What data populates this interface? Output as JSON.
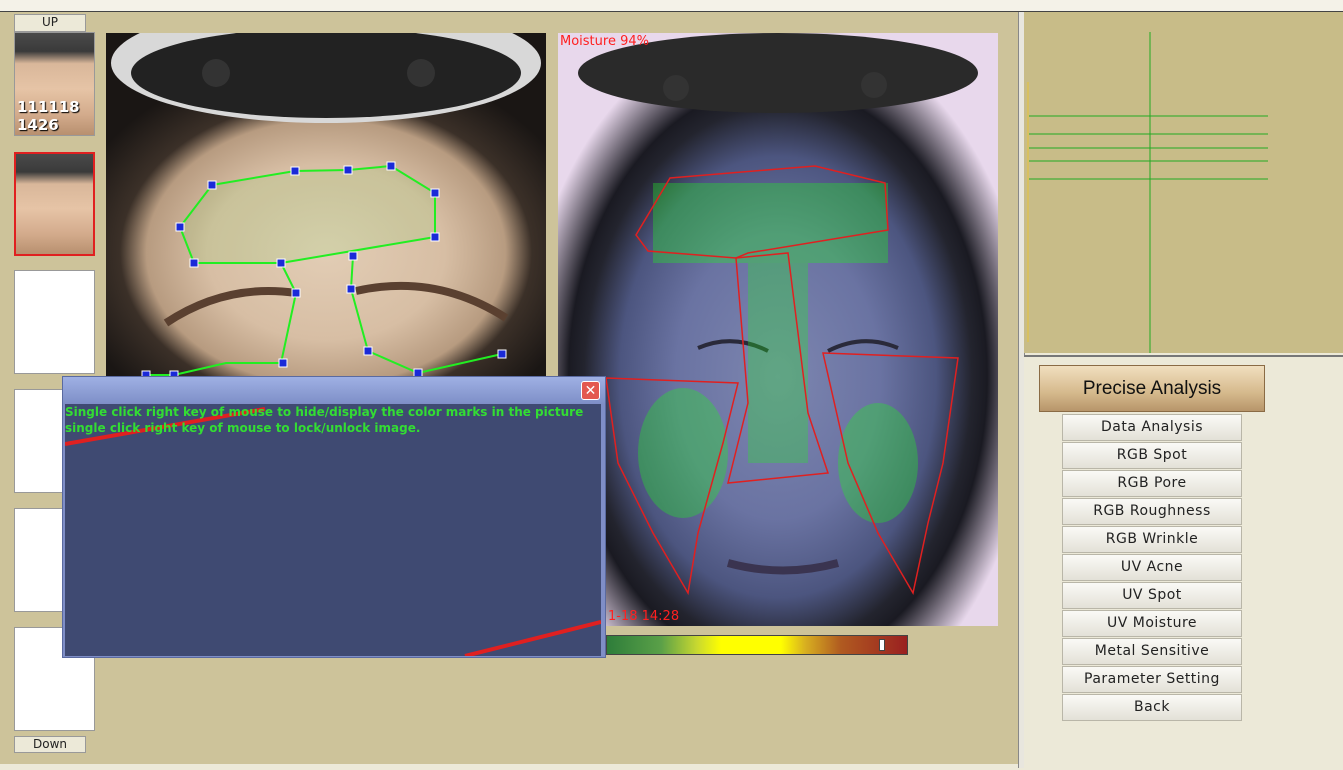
{
  "nav": {
    "up_label": "UP",
    "down_label": "Down"
  },
  "thumbnails": [
    {
      "line1": "111118",
      "line2": "1426"
    }
  ],
  "analysis_image": {
    "moisture_label": "Moisture 94%",
    "timestamp": "1-18 14:28"
  },
  "popup": {
    "close_glyph": "✕",
    "hint_line1": "Single click right key of mouse to hide/display the color marks in the picture",
    "hint_line2": "single click right key of mouse to lock/unlock image."
  },
  "menu": {
    "title": "Precise Analysis",
    "items": [
      "Data Analysis",
      "RGB Spot",
      "RGB Pore",
      "RGB Roughness",
      "RGB Wrinkle",
      "UV Acne",
      "UV Spot",
      "UV Moisture",
      "Metal Sensitive",
      "Parameter Setting",
      "Back"
    ]
  },
  "colors": {
    "marker_green": "#22ee22",
    "region_red": "#e02020",
    "selected_border": "#e02020"
  },
  "icons": [
    "close-icon"
  ]
}
